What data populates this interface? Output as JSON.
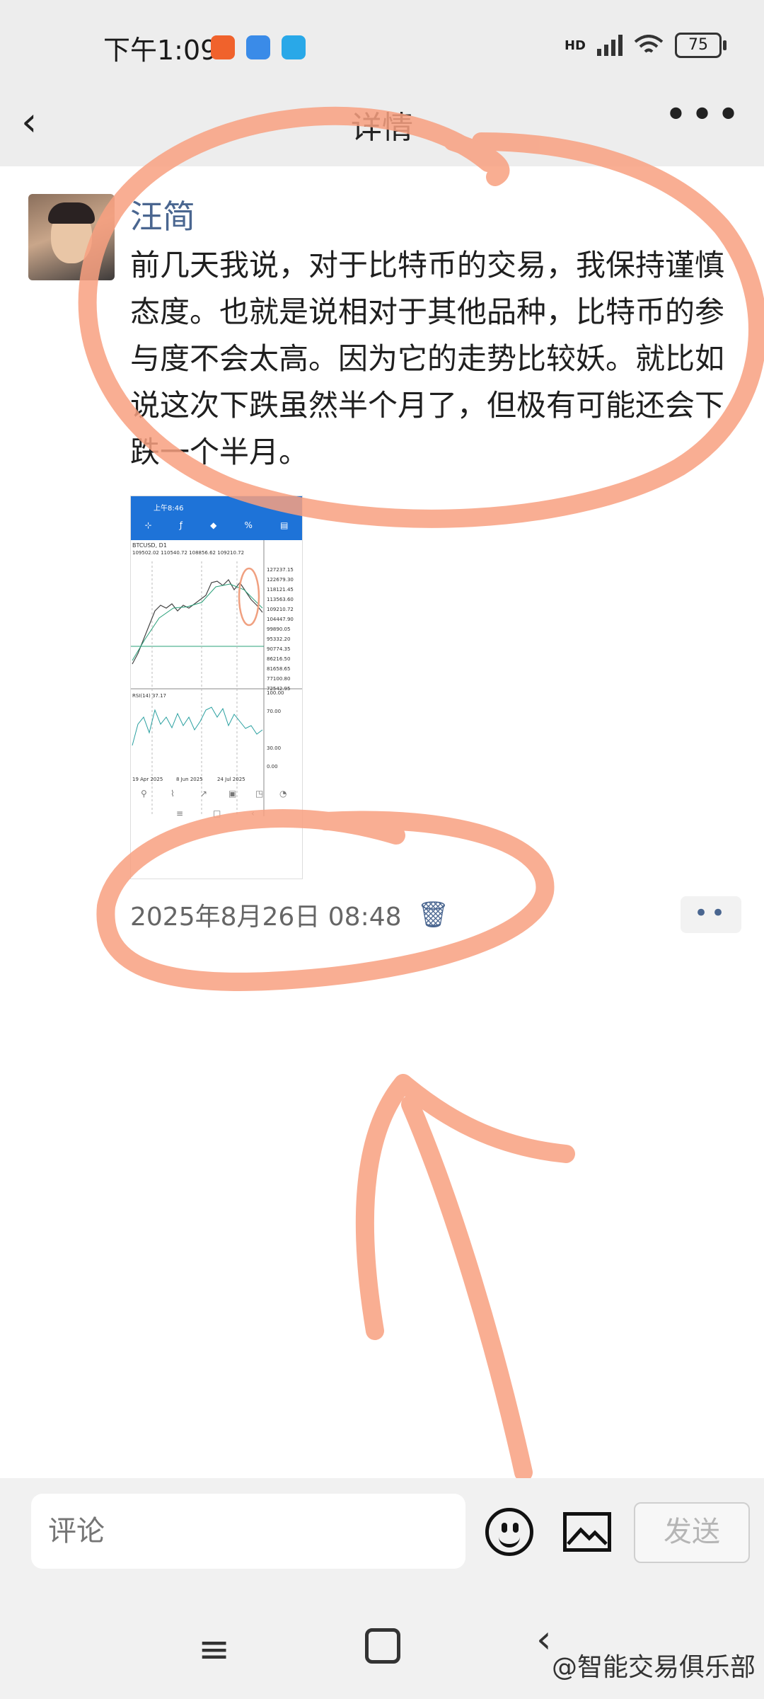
{
  "status_bar": {
    "time": "下午1:09",
    "network": "HD",
    "battery": "75"
  },
  "nav": {
    "back_label": "‹",
    "title": "详情",
    "more_label": "•••"
  },
  "post": {
    "author": "汪简",
    "text": "前几天我说，对于比特币的交易，我保持谨慎态度。也就是说相对于其他品种，比特币的参与度不会太高。因为它的走势比较妖。就比如说这次下跌虽然半个月了，但极有可能还会下跌一个半月。",
    "timestamp": "2025年8月26日 08:48"
  },
  "screenshot": {
    "time": "上午8:46",
    "symbol": "BTCUSD, D1",
    "ohlc": "109502.02 110540.72 108856.62 109210.72",
    "price_labels": [
      "127237.15",
      "122679.30",
      "118121.45",
      "113563.60",
      "109210.72",
      "104447.90",
      "99890.05",
      "95332.20",
      "90774.35",
      "86216.50",
      "81658.65",
      "77100.80",
      "72542.95"
    ],
    "rsi_label": "RSI(14) 37.17",
    "rsi_levels": [
      "100.00",
      "70.00",
      "30.00",
      "0.00"
    ],
    "date_labels": [
      "19 Apr 2025",
      "8 Jun 2025",
      "24 Jul 2025"
    ]
  },
  "comment_bar": {
    "placeholder": "评论",
    "send_label": "发送"
  },
  "watermark": "@智能交易俱乐部",
  "icons": {
    "trash": "trash-icon",
    "emoji": "emoji-icon",
    "image": "image-icon"
  }
}
